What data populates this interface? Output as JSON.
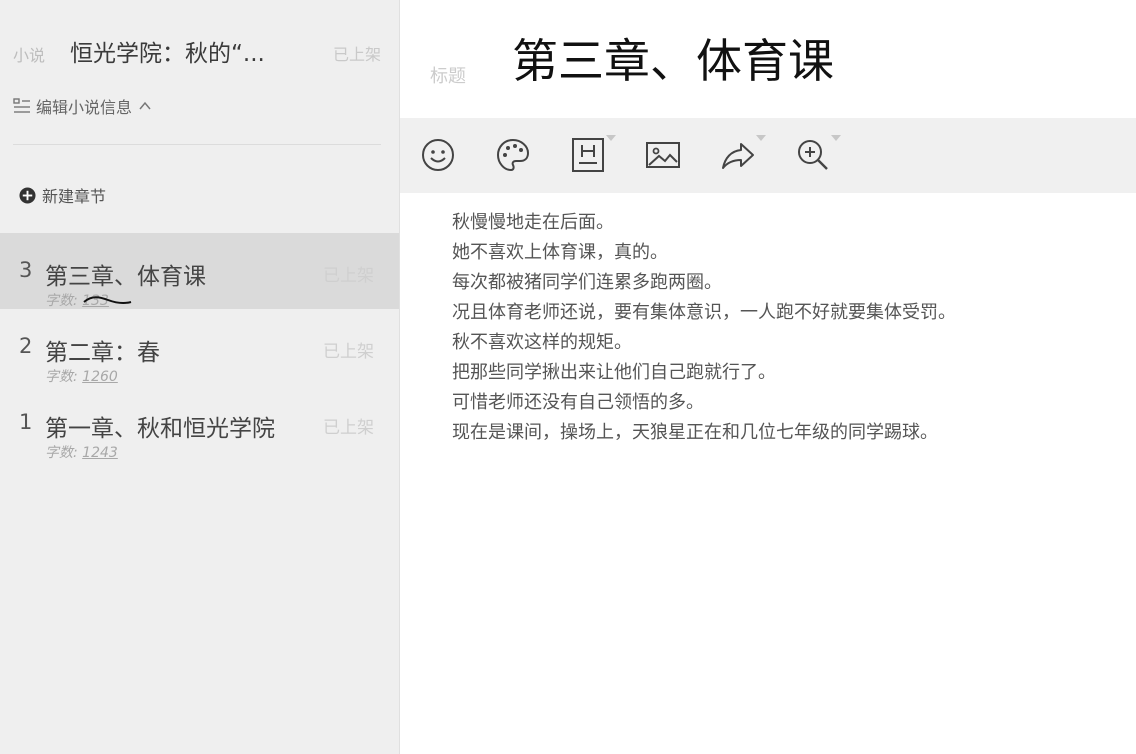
{
  "novel": {
    "tag": "小说",
    "title": "恒光学院：秋的“...",
    "status": "已上架"
  },
  "sidebar": {
    "edit_info_label": "编辑小说信息",
    "new_chapter_label": "新建章节",
    "wordcount_prefix": "字数: ",
    "chapters": [
      {
        "num": "3",
        "title": "第三章、体育课",
        "status": "已上架",
        "words": "133",
        "active": true
      },
      {
        "num": "2",
        "title": "第二章：春",
        "status": "已上架",
        "words": "1260",
        "active": false
      },
      {
        "num": "1",
        "title": "第一章、秋和恒光学院",
        "status": "已上架",
        "words": "1243",
        "active": false
      }
    ]
  },
  "editor": {
    "title_label": "标题",
    "title_value": "第三章、体育课",
    "toolbar": {
      "emoji": "emoji-icon",
      "palette": "palette-icon",
      "heading": "heading-icon",
      "image": "image-icon",
      "share": "share-icon",
      "zoom": "zoom-in-icon"
    },
    "paragraphs": [
      "秋慢慢地走在后面。",
      "她不喜欢上体育课，真的。",
      "每次都被猪同学们连累多跑两圈。",
      "况且体育老师还说，要有集体意识，一人跑不好就要集体受罚。",
      "秋不喜欢这样的规矩。",
      "把那些同学揪出来让他们自己跑就行了。",
      "可惜老师还没有自己领悟的多。",
      "现在是课间，操场上，天狼星正在和几位七年级的同学踢球。"
    ]
  },
  "colors": {
    "sidebar_bg": "#efefef",
    "active_chapter_bg": "#dadada",
    "toolbar_bg": "#f0f0f0",
    "muted_status": "#cfcfcf"
  }
}
